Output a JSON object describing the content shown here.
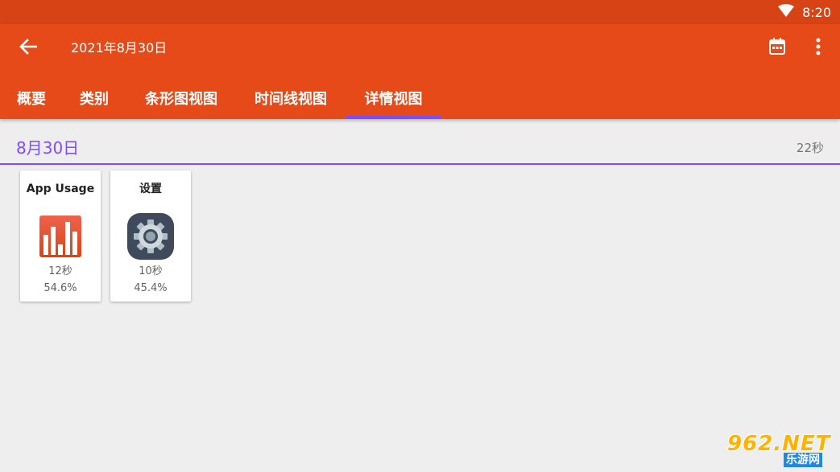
{
  "status_bar": {
    "time": "8:20",
    "wifi_icon": "wifi-icon"
  },
  "app_bar": {
    "title": "2021年8月30日",
    "back_icon": "arrow-back-icon",
    "calendar_icon": "calendar-icon",
    "more_icon": "more-vert-icon"
  },
  "tabs": [
    {
      "label": "概要"
    },
    {
      "label": "类别"
    },
    {
      "label": "条形图视图"
    },
    {
      "label": "时间线视图"
    },
    {
      "label": "详情视图"
    }
  ],
  "selected_tab": "详情视图",
  "colors": {
    "status_bar": "#d84315",
    "app_bar": "#e64a19",
    "accent": "#7c4dff",
    "background": "#eeeeee"
  },
  "day": {
    "date": "8月30日",
    "total": "22秒"
  },
  "apps": [
    {
      "name": "App Usage",
      "time": "12秒",
      "percent": "54.6%",
      "icon": "app-usage-icon"
    },
    {
      "name": "设置",
      "time": "10秒",
      "percent": "45.4%",
      "icon": "settings-gear-icon"
    }
  ],
  "watermark": {
    "top": "962.NET",
    "bottom": "乐游网"
  }
}
